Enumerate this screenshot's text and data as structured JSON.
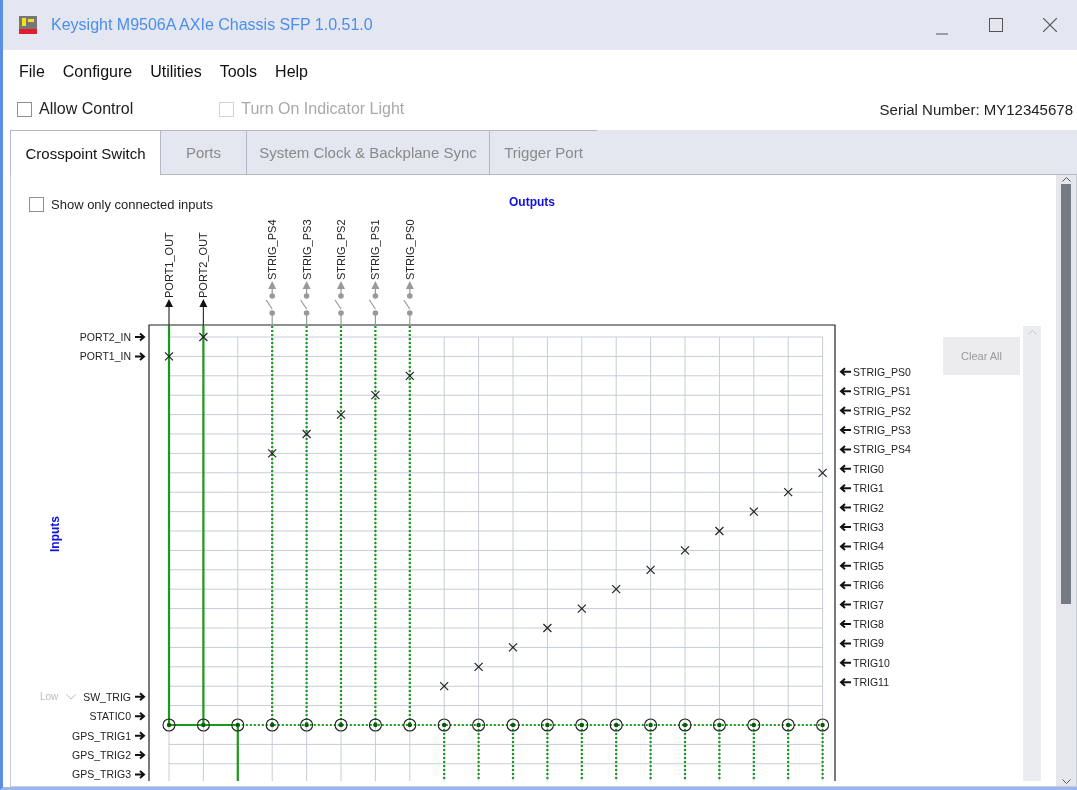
{
  "window": {
    "title": "Keysight M9506A AXIe Chassis SFP 1.0.51.0"
  },
  "menu": [
    "File",
    "Configure",
    "Utilities",
    "Tools",
    "Help"
  ],
  "options": [
    {
      "label": "Allow Control",
      "checked": false,
      "disabled": false
    },
    {
      "label": "Turn On Indicator Light",
      "checked": false,
      "disabled": true
    }
  ],
  "serial_number": "Serial Number: MY12345678",
  "tabs": [
    {
      "label": "Crosspoint Switch",
      "selected": true
    },
    {
      "label": "Ports",
      "selected": false
    },
    {
      "label": "System Clock & Backplane Sync",
      "selected": false
    },
    {
      "label": "Trigger Port",
      "selected": false
    }
  ],
  "crosspoint": {
    "show_connected": {
      "label": "Show only connected inputs",
      "checked": false
    },
    "outputs_title": "Outputs",
    "inputs_title": "Inputs",
    "clear_button": {
      "label": "Clear All",
      "disabled": true
    },
    "level_select": {
      "value": "Low",
      "disabled": true
    },
    "columns": [
      {
        "label": "PORT1_OUT",
        "kind": "port"
      },
      {
        "label": "PORT2_OUT",
        "kind": "port"
      },
      {
        "kind": "bus_solid"
      },
      {
        "label": "STRIG_PS4",
        "kind": "switch"
      },
      {
        "label": "STRIG_PS3",
        "kind": "switch"
      },
      {
        "label": "STRIG_PS2",
        "kind": "switch"
      },
      {
        "label": "STRIG_PS1",
        "kind": "switch"
      },
      {
        "label": "STRIG_PS0",
        "kind": "switch"
      },
      {
        "kind": "bus_dotted"
      },
      {
        "kind": "bus_dotted"
      },
      {
        "kind": "bus_dotted"
      },
      {
        "kind": "bus_dotted"
      },
      {
        "kind": "bus_dotted"
      },
      {
        "kind": "bus_dotted"
      },
      {
        "kind": "bus_dotted"
      },
      {
        "kind": "bus_dotted"
      },
      {
        "kind": "bus_dotted"
      },
      {
        "kind": "bus_dotted"
      },
      {
        "kind": "bus_dotted"
      },
      {
        "kind": "bus_dotted"
      }
    ],
    "inputs": [
      {
        "label": "PORT2_IN",
        "connected": true
      },
      {
        "label": "PORT1_IN",
        "connected": true
      },
      {
        "label": "SW_TRIG"
      },
      {
        "label": "STATIC0"
      },
      {
        "label": "GPS_TRIG1"
      },
      {
        "label": "GPS_TRIG2"
      },
      {
        "label": "GPS_TRIG3"
      }
    ],
    "right_outputs": [
      {
        "label": "STRIG_PS0",
        "connected": true
      },
      {
        "label": "STRIG_PS1",
        "connected": true
      },
      {
        "label": "STRIG_PS2",
        "connected": true
      },
      {
        "label": "STRIG_PS3",
        "connected": true
      },
      {
        "label": "STRIG_PS4",
        "connected": true
      },
      {
        "label": "TRIG0",
        "connected": true
      },
      {
        "label": "TRIG1",
        "connected": true
      },
      {
        "label": "TRIG2",
        "connected": true
      },
      {
        "label": "TRIG3",
        "connected": true
      },
      {
        "label": "TRIG4",
        "connected": true
      },
      {
        "label": "TRIG5",
        "connected": true
      },
      {
        "label": "TRIG6",
        "connected": true
      },
      {
        "label": "TRIG7",
        "connected": true
      },
      {
        "label": "TRIG8",
        "connected": true
      },
      {
        "label": "TRIG9",
        "connected": true
      },
      {
        "label": "TRIG10",
        "connected": true
      },
      {
        "label": "TRIG11",
        "connected": true
      }
    ]
  }
}
